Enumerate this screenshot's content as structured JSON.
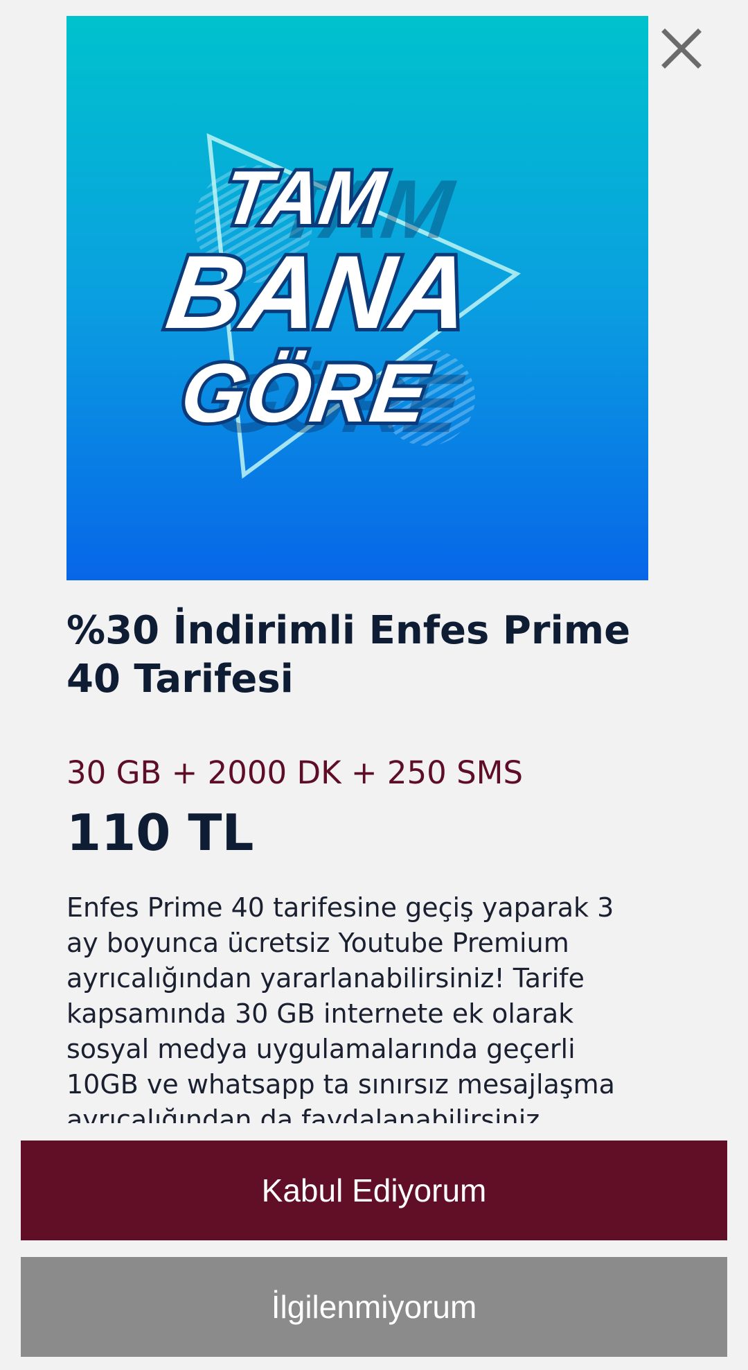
{
  "banner": {
    "line1": "TAM",
    "line2": "BANA",
    "line3": "GÖRE",
    "gradient_top": "#00c2cc",
    "gradient_bottom": "#0766e8"
  },
  "close_icon": "close-icon",
  "offer": {
    "title": "%30 İndirimli Enfes Prime 40 Tarifesi",
    "package": "30 GB + 2000 DK + 250 SMS",
    "price": "110 TL",
    "description": "Enfes Prime 40 tarifesine geçiş yaparak 3 ay boyunca ücretsiz Youtube Premium ayrıcalığından yararlanabilirsiniz! Tarife kapsamında 30 GB internete ek olarak sosyal medya uygulamalarında geçerli 10GB ve whatsapp ta sınırsız mesajlaşma ayrıcalığından da faydalanabilirsiniz."
  },
  "actions": {
    "accept_label": "Kabul Ediyorum",
    "decline_label": "İlgilenmiyorum",
    "accept_color": "#610f27",
    "decline_color": "#8b8b8b"
  }
}
